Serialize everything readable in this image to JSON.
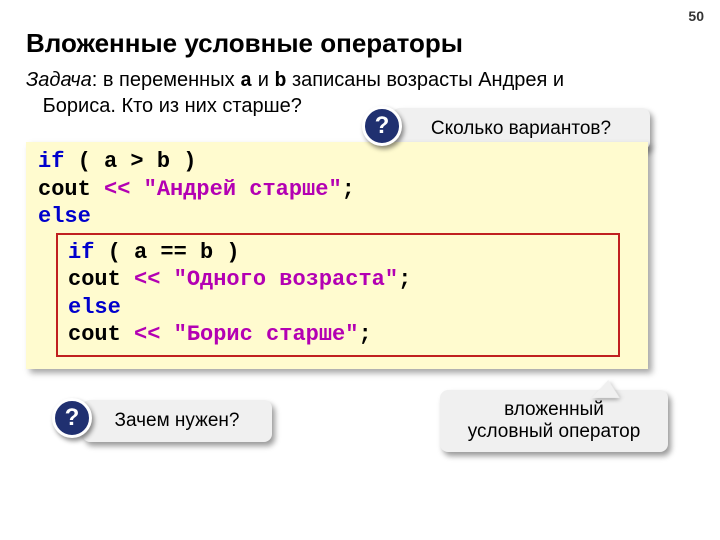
{
  "page_number": "50",
  "title": "Вложенные условные операторы",
  "task": {
    "label": "Задача",
    "sep": ": ",
    "t1": "в переменных ",
    "var_a": "a",
    "t2": " и ",
    "var_b": "b",
    "t3": " записаны возрасты Андрея и",
    "line2": "Бориса. Кто из них старше?"
  },
  "callouts": {
    "q": "?",
    "variants": "Сколько вариантов?",
    "why": "Зачем нужен?",
    "nested_l1": "вложенный",
    "nested_l2": "условный оператор"
  },
  "code": {
    "outer": {
      "l1": {
        "kw": "if",
        "rest": " ( a > b )"
      },
      "l2": {
        "pre": "   cout ",
        "op": "<<",
        "space": " ",
        "str": "\"Андрей старше\"",
        "end": ";"
      },
      "l3": {
        "kw": "else"
      }
    },
    "inner": {
      "l1": {
        "kw": "if",
        "rest": " ( a == b )"
      },
      "l2": {
        "pre": "  cout ",
        "op": "<<",
        "space": " ",
        "str": "\"Одного возраста\"",
        "end": ";"
      },
      "l3": {
        "kw": "else"
      },
      "l4": {
        "pre": "  cout ",
        "op": "<<",
        "space": " ",
        "str": "\"Борис старше\"",
        "end": ";"
      }
    }
  }
}
